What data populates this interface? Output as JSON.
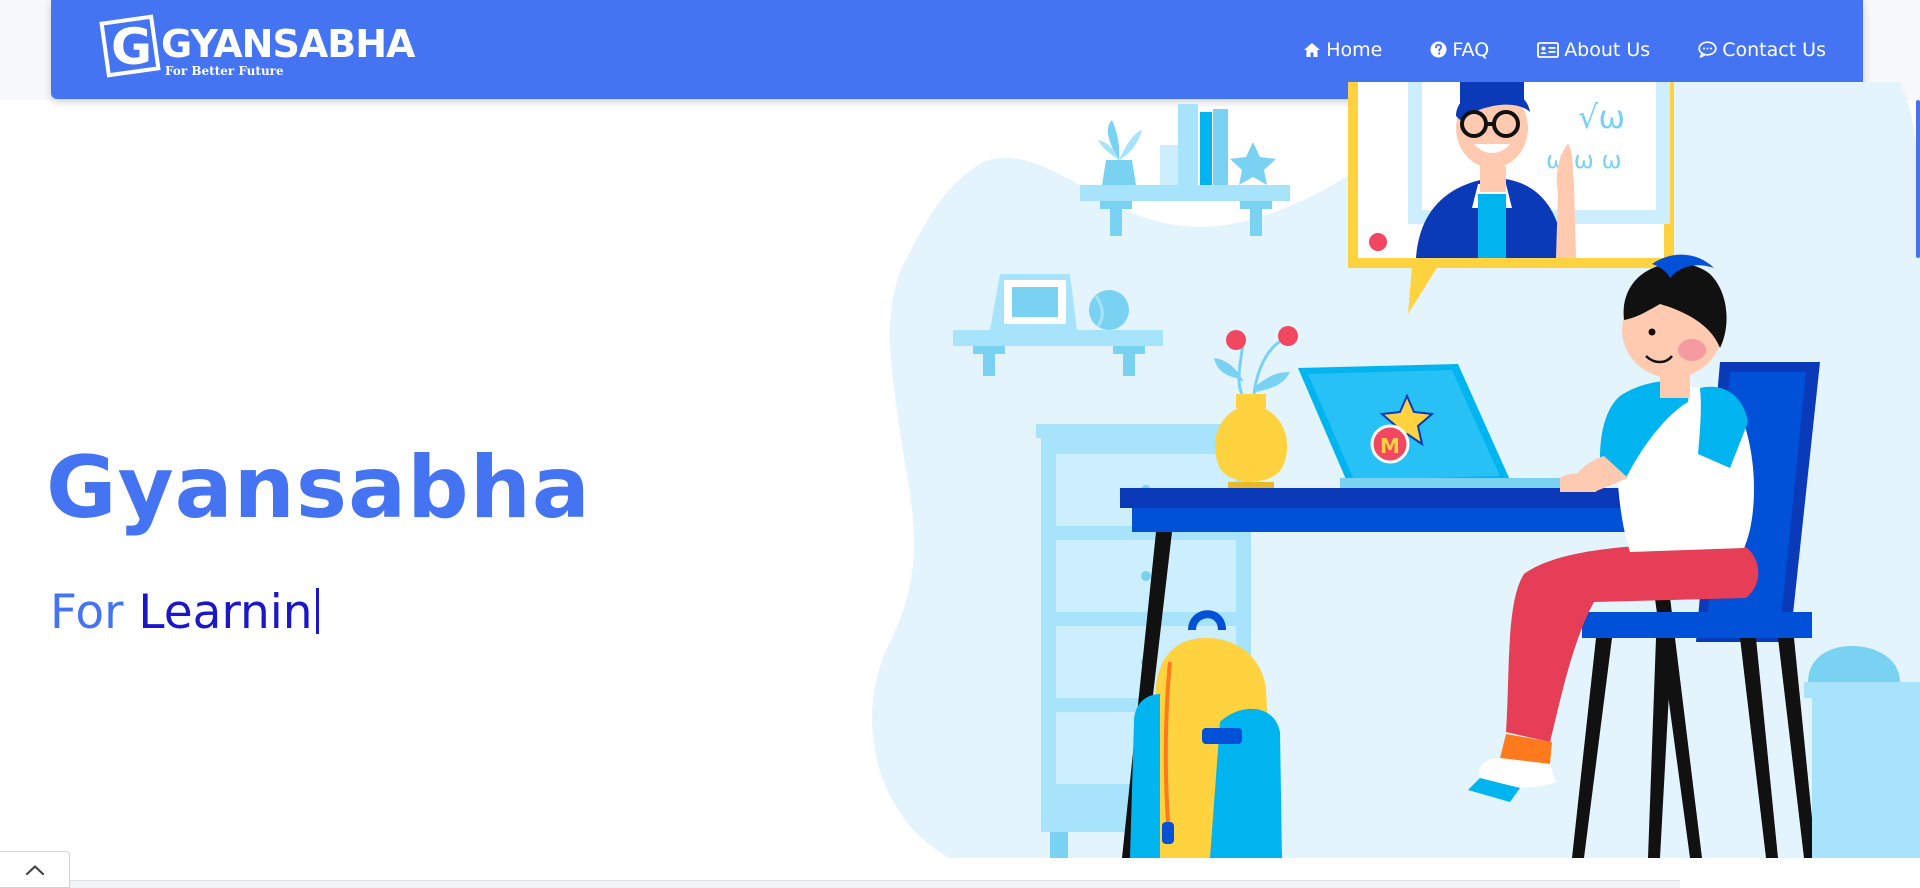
{
  "brand": {
    "name": "GYANSABHA",
    "mark_letter": "G",
    "tagline": "For Better Future"
  },
  "nav": {
    "items": [
      {
        "label": "Home",
        "icon": "home-icon"
      },
      {
        "label": "FAQ",
        "icon": "question-circle-icon"
      },
      {
        "label": "About Us",
        "icon": "id-card-icon"
      },
      {
        "label": "Contact Us",
        "icon": "chat-bubble-icon"
      }
    ]
  },
  "hero": {
    "title": "Gyansabha",
    "subtitle_prefix": "For",
    "subtitle_typed": "Learnin"
  },
  "illustration": {
    "board_writing": "√ω",
    "board_scribble": "ω ω ω",
    "sticker_letter": "M"
  },
  "colors": {
    "primary": "#4574f2",
    "typed_text": "#1a17c9",
    "illustration_light": "#e4f4fc",
    "illustration_blue": "#0a3ab8"
  }
}
